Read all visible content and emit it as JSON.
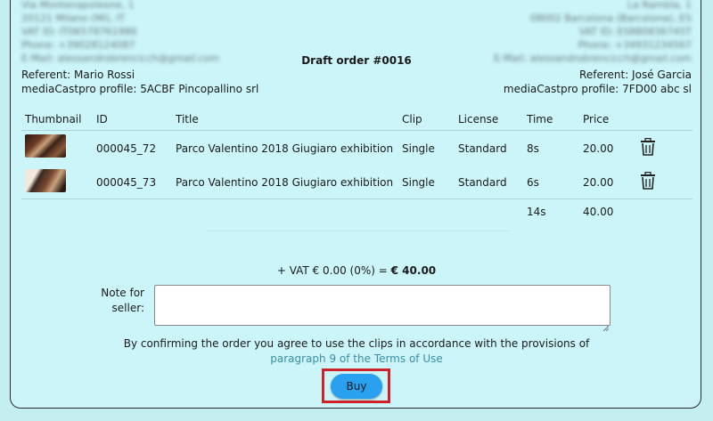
{
  "seller_address": {
    "street": "Via Montenapoleone, 1",
    "city": "20121 Milano (MI), IT",
    "vat": "VAT ID: IT06578761986",
    "phone": "Phone: +39028124087",
    "email": "E-Mail: alessandrobrencicch@gmail.com"
  },
  "buyer_address": {
    "street": "La Rambla, 1",
    "city": "08002 Barcelona (Barcelona), ES",
    "vat": "VAT ID: ES88083674ST",
    "phone": "Phone: +34931234567",
    "email": "E-Mail: alessandrobrencicch@gmail.com"
  },
  "order_title": "Draft order #0016",
  "seller": {
    "referent": "Referent: Mario Rossi",
    "profile": "mediaCastpro profile: 5ACBF Pincopallino srl"
  },
  "buyer": {
    "referent": "Referent: José Garcia",
    "profile": "mediaCastpro profile: 7FD00 abc sl"
  },
  "table": {
    "headers": [
      "Thumbnail",
      "ID",
      "Title",
      "Clip",
      "License",
      "Time",
      "Price"
    ],
    "rows": [
      {
        "id": "000045_72",
        "title": "Parco Valentino 2018 Giugiaro exhibition",
        "clip": "Single",
        "license": "Standard",
        "time": "8s",
        "price": "20.00",
        "delete_icon": "trash-icon"
      },
      {
        "id": "000045_73",
        "title": "Parco Valentino 2018 Giugiaro exhibition",
        "clip": "Single",
        "license": "Standard",
        "time": "6s",
        "price": "20.00",
        "delete_icon": "trash-icon"
      }
    ],
    "total_time": "14s",
    "total_price": "40.00"
  },
  "vat_line": {
    "prefix": "+ VAT € 0.00 (0%) = ",
    "total": "€ 40.00"
  },
  "note": {
    "label": "Note for seller:",
    "value": ""
  },
  "terms": {
    "text": "By confirming the order you agree to use the clips in accordance with the provisions of ",
    "link": "paragraph 9 of the Terms of Use"
  },
  "buy_label": "Buy",
  "colors": {
    "background": "#c5eef1",
    "card": "#cbf5f9",
    "buy_button": "#2aa1ee",
    "highlight": "#d0202a",
    "link": "#3b8fa6"
  }
}
